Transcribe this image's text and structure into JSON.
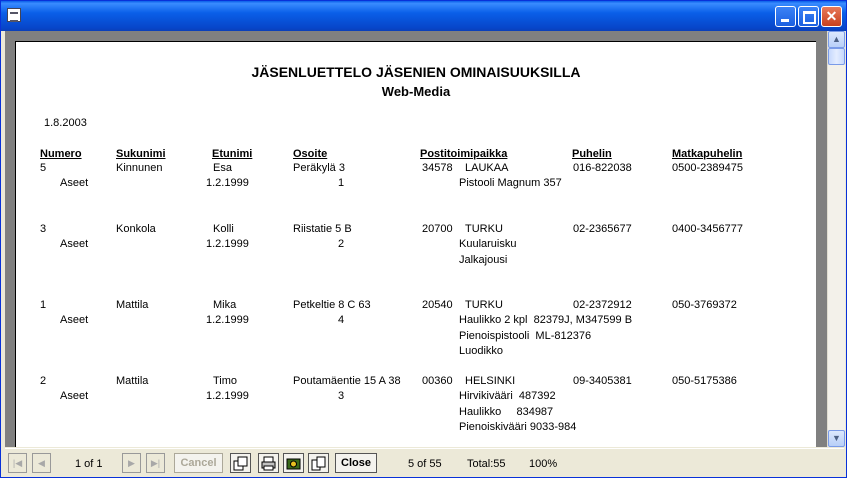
{
  "report": {
    "title": "JÄSENLUETTELO JÄSENIEN OMINAISUUKSILLA",
    "subtitle": "Web-Media",
    "date": "1.8.2003",
    "columns": [
      "Numero",
      "Sukunimi",
      "Etunimi",
      "Osoite",
      "Postitoimipaikka",
      "Puhelin",
      "Matkapuhelin"
    ],
    "assets_label": "Aseet",
    "members": [
      {
        "numero": "5",
        "sukunimi": "Kinnunen",
        "etunimi": "Esa",
        "osoite": "Peräkylä 3",
        "postinumero": "34578",
        "postitoimipaikka": "LAUKAA",
        "puhelin": "016-822038",
        "matkapuhelin": "0500-2389475",
        "date": "1.2.1999",
        "count": "1",
        "assets": [
          "Pistooli Magnum 357"
        ]
      },
      {
        "numero": "3",
        "sukunimi": "Konkola",
        "etunimi": "Kolli",
        "osoite": "Riistatie 5 B",
        "postinumero": "20700",
        "postitoimipaikka": "TURKU",
        "puhelin": "02-2365677",
        "matkapuhelin": "0400-3456777",
        "date": "1.2.1999",
        "count": "2",
        "assets": [
          "Kuularuisku",
          "Jalkajousi"
        ]
      },
      {
        "numero": "1",
        "sukunimi": "Mattila",
        "etunimi": "Mika",
        "osoite": "Petkeltie 8 C 63",
        "postinumero": "20540",
        "postitoimipaikka": "TURKU",
        "puhelin": "02-2372912",
        "matkapuhelin": "050-3769372",
        "date": "1.2.1999",
        "count": "4",
        "assets": [
          "Haulikko 2 kpl  82379J, M347599 B",
          "Pienoispistooli  ML-812376",
          "Luodikko"
        ]
      },
      {
        "numero": "2",
        "sukunimi": "Mattila",
        "etunimi": "Timo",
        "osoite": "Poutamäentie 15 A 38",
        "postinumero": "00360",
        "postitoimipaikka": "HELSINKI",
        "puhelin": "09-3405381",
        "matkapuhelin": "050-5175386",
        "date": "1.2.1999",
        "count": "3",
        "assets": [
          "Hirvikivääri  487392",
          "Haulikko     834987",
          "Pienoiskivääri 9033-984"
        ]
      }
    ]
  },
  "toolbar": {
    "page_indicator": "1 of 1",
    "cancel_label": "Cancel",
    "close_label": "Close",
    "record_status": "5 of 55",
    "total": "Total:55",
    "zoom": "100%"
  },
  "icons": {
    "first": "first-page-icon",
    "prev": "previous-page-icon",
    "next": "next-page-icon",
    "last": "last-page-icon",
    "export": "export-icon",
    "print": "print-icon",
    "camera": "camera-icon",
    "copy": "copy-icon"
  },
  "colors": {
    "titlebar": "#0a5fe8",
    "close_button": "#d65a36",
    "viewer_bg": "#808080"
  }
}
